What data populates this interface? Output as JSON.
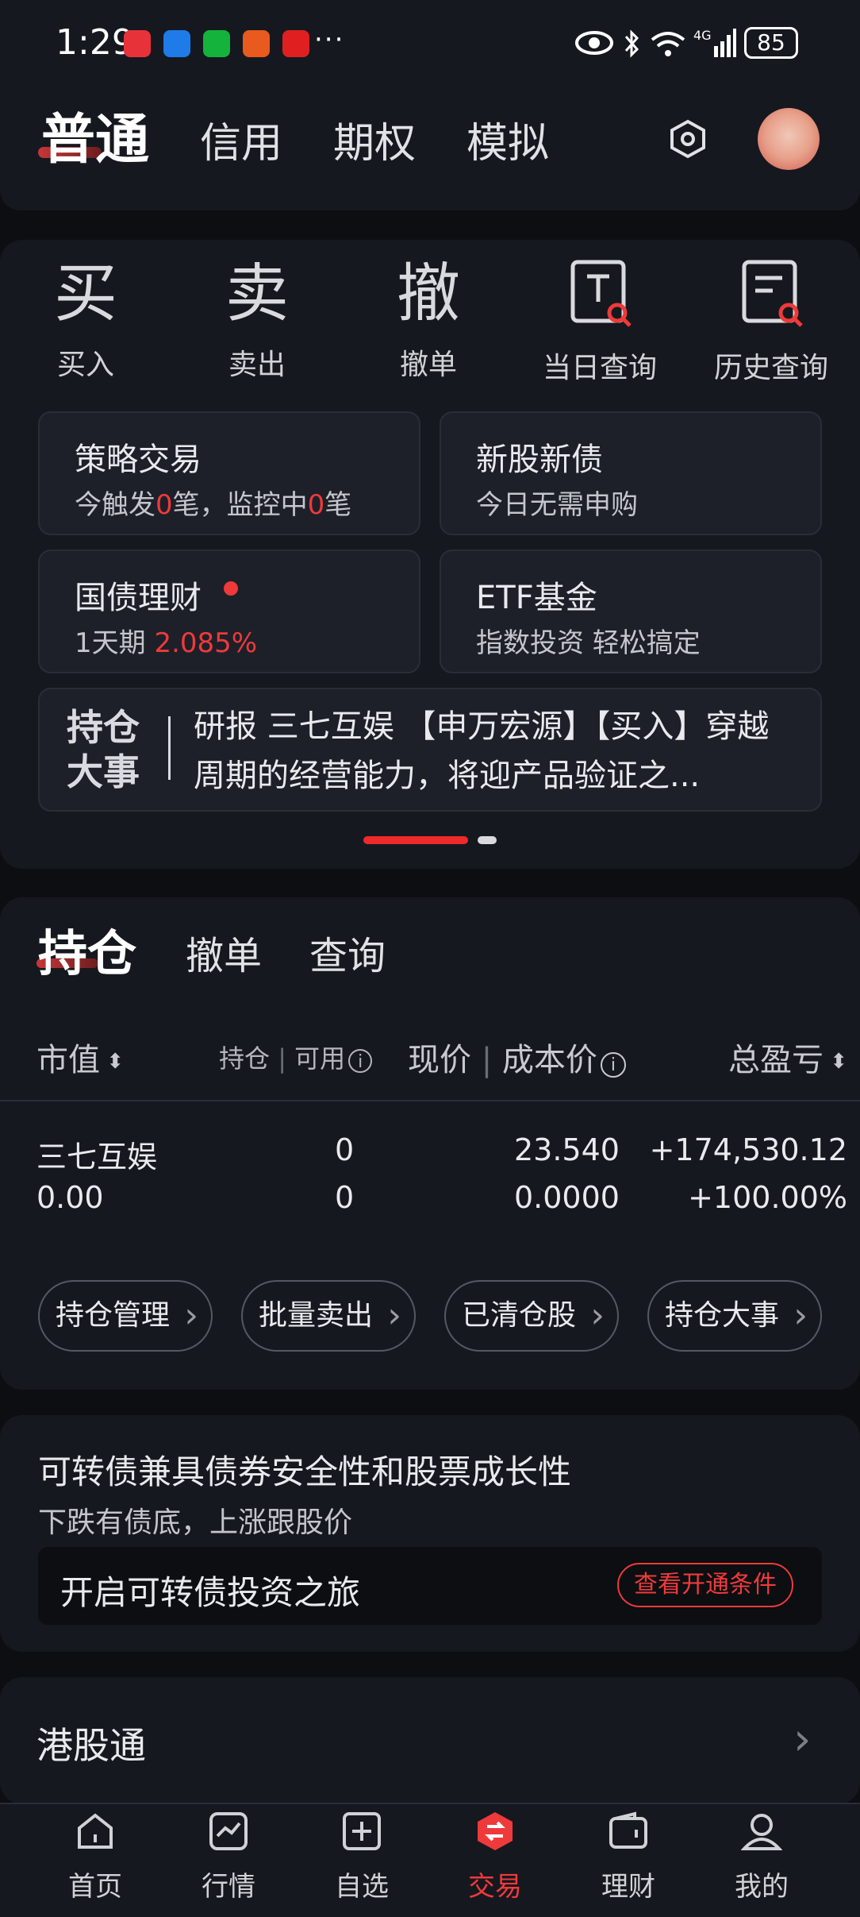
{
  "status_bar": {
    "time": "1:29",
    "more": "···",
    "battery": "85"
  },
  "header": {
    "tabs": [
      "普通",
      "信用",
      "期权",
      "模拟"
    ],
    "settings_icon": "hexagon-gear-icon",
    "avatar_icon": "avatar-icon"
  },
  "quick_actions": [
    {
      "label": "买入",
      "glyph": "买"
    },
    {
      "label": "卖出",
      "glyph": "卖"
    },
    {
      "label": "撤单",
      "glyph": "撤"
    },
    {
      "label": "当日查询",
      "icon": "today-query-icon"
    },
    {
      "label": "历史查询",
      "icon": "history-query-icon"
    }
  ],
  "cards": {
    "strategy": {
      "title": "策略交易",
      "sub_a": "今触发",
      "sub_b": "0",
      "sub_c": "笔，监控中",
      "sub_d": "0",
      "sub_e": "笔"
    },
    "ipo": {
      "title": "新股新债",
      "sub": "今日无需申购"
    },
    "bond": {
      "title": "国债理财",
      "sub_a": "1天期 ",
      "sub_b": "2.085%"
    },
    "etf": {
      "title": "ETF基金",
      "sub": "指数投资 轻松搞定"
    }
  },
  "news": {
    "badge": "持仓大事",
    "text": "研报 三七互娱 【申万宏源】【买入】穿越周期的经营能力，将迎产品验证之..."
  },
  "holdings": {
    "tabs": [
      "持仓",
      "撤单",
      "查询"
    ],
    "columns": {
      "market_value": "市值",
      "position": "持仓",
      "sep1": "|",
      "available": "可用",
      "price": "现价",
      "sep2": "|",
      "cost": "成本价",
      "pnl": "总盈亏"
    },
    "rows": [
      {
        "name": "三七互娱",
        "market_value": "0.00",
        "position": "0",
        "available": "0",
        "price": "23.540",
        "cost": "0.0000",
        "pnl": "+174,530.12",
        "pnl_pct": "+100.00%"
      }
    ],
    "actions": [
      "持仓管理",
      "批量卖出",
      "已清仓股",
      "持仓大事"
    ]
  },
  "convertible": {
    "title": "可转债兼具债券安全性和股票成长性",
    "subtitle": "下跌有债底，上涨跟股价",
    "box_text": "开启可转债投资之旅",
    "button": "查看开通条件"
  },
  "hk": {
    "title": "港股通"
  },
  "bottom_nav": [
    {
      "label": "首页",
      "icon": "home-icon"
    },
    {
      "label": "行情",
      "icon": "market-chart-icon"
    },
    {
      "label": "自选",
      "icon": "add-watchlist-icon"
    },
    {
      "label": "交易",
      "icon": "trade-icon",
      "active": true
    },
    {
      "label": "理财",
      "icon": "wallet-icon"
    },
    {
      "label": "我的",
      "icon": "profile-icon"
    }
  ],
  "colors": {
    "accent": "#ee3a3a",
    "background": "#0c0e12",
    "panel": "#16181f"
  }
}
